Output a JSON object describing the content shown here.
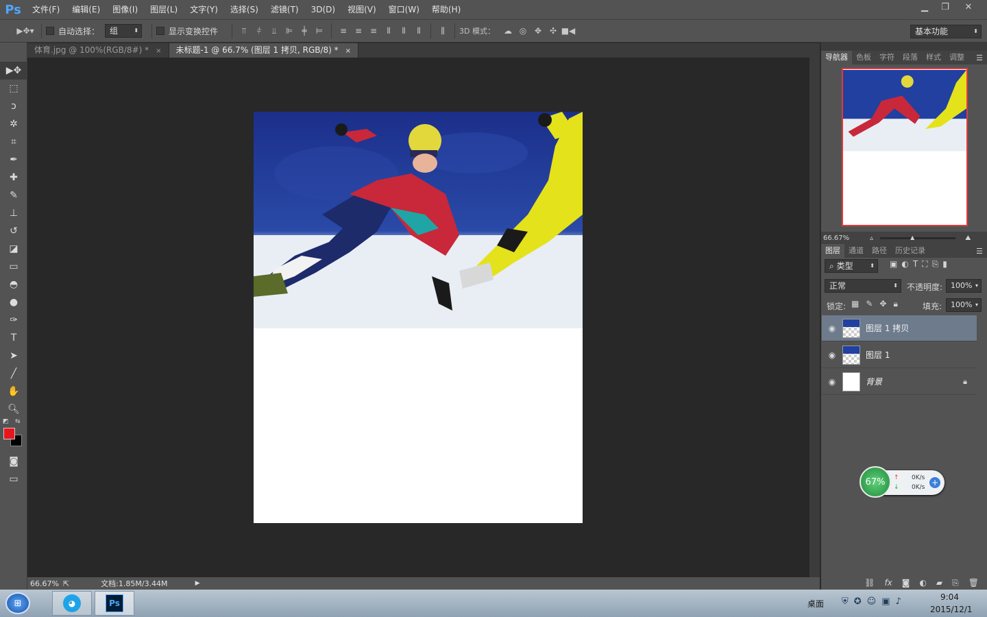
{
  "app": {
    "logo": "Ps"
  },
  "menu": [
    "文件(F)",
    "编辑(E)",
    "图像(I)",
    "图层(L)",
    "文字(Y)",
    "选择(S)",
    "滤镜(T)",
    "3D(D)",
    "视图(V)",
    "窗口(W)",
    "帮助(H)"
  ],
  "options": {
    "auto_select_label": "自动选择：",
    "auto_select_value": "组",
    "show_transform_label": "显示变换控件",
    "mode3d_label": "3D 模式：",
    "workspace_value": "基本功能"
  },
  "tabs": [
    {
      "label": "体育.jpg @ 100%(RGB/8#) *"
    },
    {
      "label": "未标题-1 @ 66.7% (图层 1 拷贝, RGB/8) *"
    }
  ],
  "tab_close": "×",
  "status": {
    "zoom": "66.67%",
    "doc": "文档:1.85M/3.44M"
  },
  "navigator": {
    "tabs": [
      "导航器",
      "色板",
      "字符",
      "段落",
      "样式",
      "调整"
    ],
    "zoom": "66.67%"
  },
  "layers": {
    "tabs": [
      "图层",
      "通道",
      "路径",
      "历史记录"
    ],
    "filter_label": "类型",
    "blend_mode": "正常",
    "opacity_label": "不透明度:",
    "opacity_value": "100%",
    "lock_label": "锁定:",
    "fill_label": "填充:",
    "fill_value": "100%",
    "items": [
      {
        "name": "图层 1 拷贝"
      },
      {
        "name": "图层 1"
      },
      {
        "name": "背景"
      }
    ]
  },
  "layers_footer": {
    "fx": "fx"
  },
  "netwidget": {
    "percent": "67%",
    "up": "0K/s",
    "down": "0K/s"
  },
  "taskbar": {
    "desktop_label": "桌面",
    "time": "9:04",
    "date": "2015/12/1",
    "ps_label": "Ps"
  },
  "colors": {
    "foreground": "#e8161c",
    "background": "#000000",
    "accent": "#4fa6ff"
  }
}
